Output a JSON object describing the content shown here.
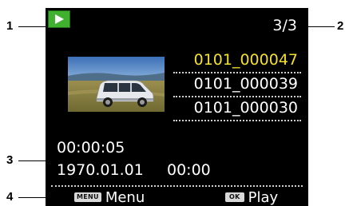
{
  "callouts": [
    "1",
    "2",
    "3",
    "4"
  ],
  "header": {
    "mode_icon": "play-icon",
    "mode_icon_color": "#3fb12f",
    "counter": "3/3"
  },
  "files": [
    {
      "name": "0101_000047",
      "selected": true
    },
    {
      "name": "0101_000039",
      "selected": false
    },
    {
      "name": "0101_000030",
      "selected": false
    }
  ],
  "colors": {
    "selected": "#f4e02a",
    "text": "#ffffff",
    "background": "#000000"
  },
  "info": {
    "duration": "00:00:05",
    "date": "1970.01.01",
    "time": "00:00"
  },
  "footer": {
    "menu_key": "MENU",
    "menu_label": "Menu",
    "ok_key": "OK",
    "play_label": "Play"
  }
}
